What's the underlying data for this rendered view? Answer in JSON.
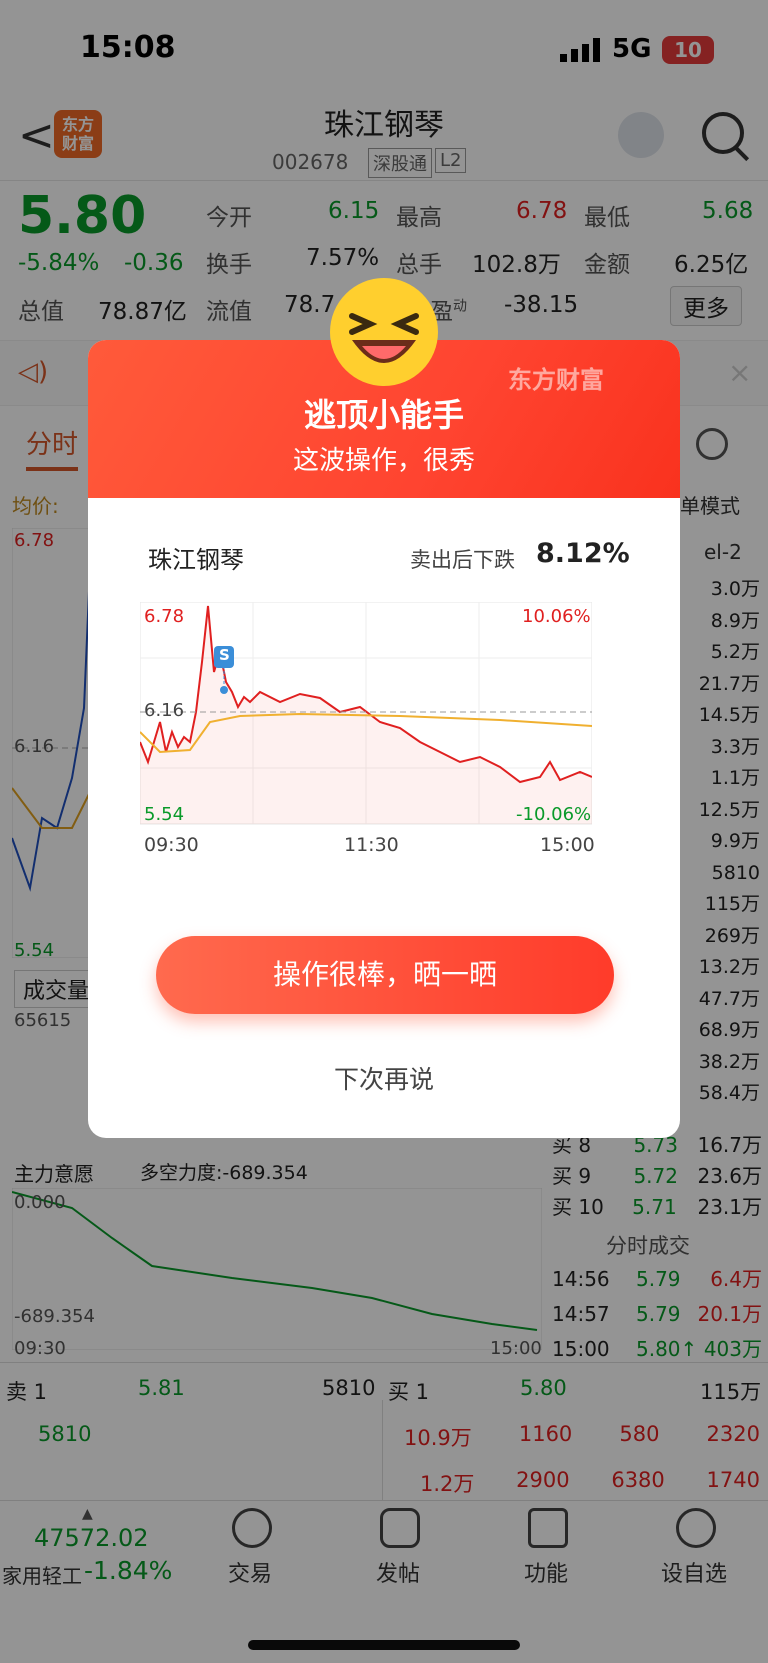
{
  "status": {
    "time": "15:08",
    "network": "5G",
    "battery": "10"
  },
  "header": {
    "back": "<",
    "logo_line1": "东方",
    "logo_line2": "财富",
    "name": "珠江钢琴",
    "code": "002678",
    "tag": "深股通",
    "level": "L2"
  },
  "quote": {
    "price": "5.80",
    "change_pct": "-5.84%",
    "change": "-0.36",
    "open_label": "今开",
    "open": "6.15",
    "high_label": "最高",
    "high": "6.78",
    "low_label": "最低",
    "low": "5.68",
    "turnover_label": "换手",
    "turnover": "7.57%",
    "volume_label": "总手",
    "volume": "102.8万",
    "amount_label": "金额",
    "amount": "6.25亿",
    "mktcap_label": "总值",
    "mktcap": "78.87亿",
    "float_label": "流值",
    "float": "78.7",
    "pe_label": "盈",
    "pe_sup": "动",
    "pe": "-38.15",
    "more": "更多"
  },
  "background": {
    "tab_active": "分时",
    "avg_label": "均价:",
    "mode": "单模式",
    "level2": "el-2",
    "price_top": "6.78",
    "price_mid": "6.16",
    "price_bot": "5.54",
    "vol_label": "成交量",
    "vol_max": "65615",
    "side_vols": [
      "3.0万",
      "8.9万",
      "5.2万",
      "21.7万",
      "14.5万",
      "3.3万",
      "1.1万",
      "12.5万",
      "9.9万",
      "5810",
      "115万",
      "269万",
      "13.2万",
      "47.7万",
      "68.9万",
      "38.2万",
      "58.4万"
    ],
    "buy_rows": [
      {
        "label": "买 8",
        "price": "5.73",
        "vol": "16.7万"
      },
      {
        "label": "买 9",
        "price": "5.72",
        "vol": "23.6万"
      },
      {
        "label": "买 10",
        "price": "5.71",
        "vol": "23.1万"
      }
    ],
    "flow_label": "主力意愿",
    "flow_power": "多空力度:-689.354",
    "flow_top": "0.000",
    "flow_bot": "-689.354",
    "time_start": "09:30",
    "time_end": "15:00",
    "ticks_title": "分时成交",
    "ticks": [
      {
        "time": "14:56",
        "price": "5.79",
        "vol": "6.4万"
      },
      {
        "time": "14:57",
        "price": "5.79",
        "vol": "20.1万"
      },
      {
        "time": "15:00",
        "price": "5.80↑",
        "vol": "403万"
      }
    ],
    "sell1_label": "卖 1",
    "sell1_price": "5.81",
    "sell1_vol": "5810",
    "buy1_label": "买 1",
    "buy1_price": "5.80",
    "buy1_vol": "115万",
    "sell_sub": "5810",
    "buy_sub_row1": [
      "10.9万",
      "1160",
      "580",
      "2320"
    ],
    "buy_sub_row2": [
      "1.2万",
      "2900",
      "6380",
      "1740"
    ]
  },
  "modal": {
    "brand": "东方财富",
    "title": "逃顶小能手",
    "subtitle": "这波操作，很秀",
    "stock": "珠江钢琴",
    "drop_label": "卖出后下跌",
    "drop_value": "8.12%",
    "sell_marker": "S",
    "chart_labels": {
      "top_left": "6.78",
      "mid_left": "6.16",
      "bot_left": "5.54",
      "top_right": "10.06%",
      "bot_right": "-10.06%",
      "x_start": "09:30",
      "x_mid": "11:30",
      "x_end": "15:00"
    },
    "share_button": "操作很棒，晒一晒",
    "later": "下次再说"
  },
  "nav": {
    "index_value": "47572.02",
    "index_name": "家用轻工",
    "index_change": "-1.84%",
    "items": [
      "交易",
      "发帖",
      "功能",
      "设自选"
    ]
  },
  "chart_data": {
    "type": "line",
    "x": [
      "09:30",
      "11:30",
      "15:00"
    ],
    "ylim": [
      5.54,
      6.78
    ],
    "reference": 6.16,
    "series": []
  }
}
